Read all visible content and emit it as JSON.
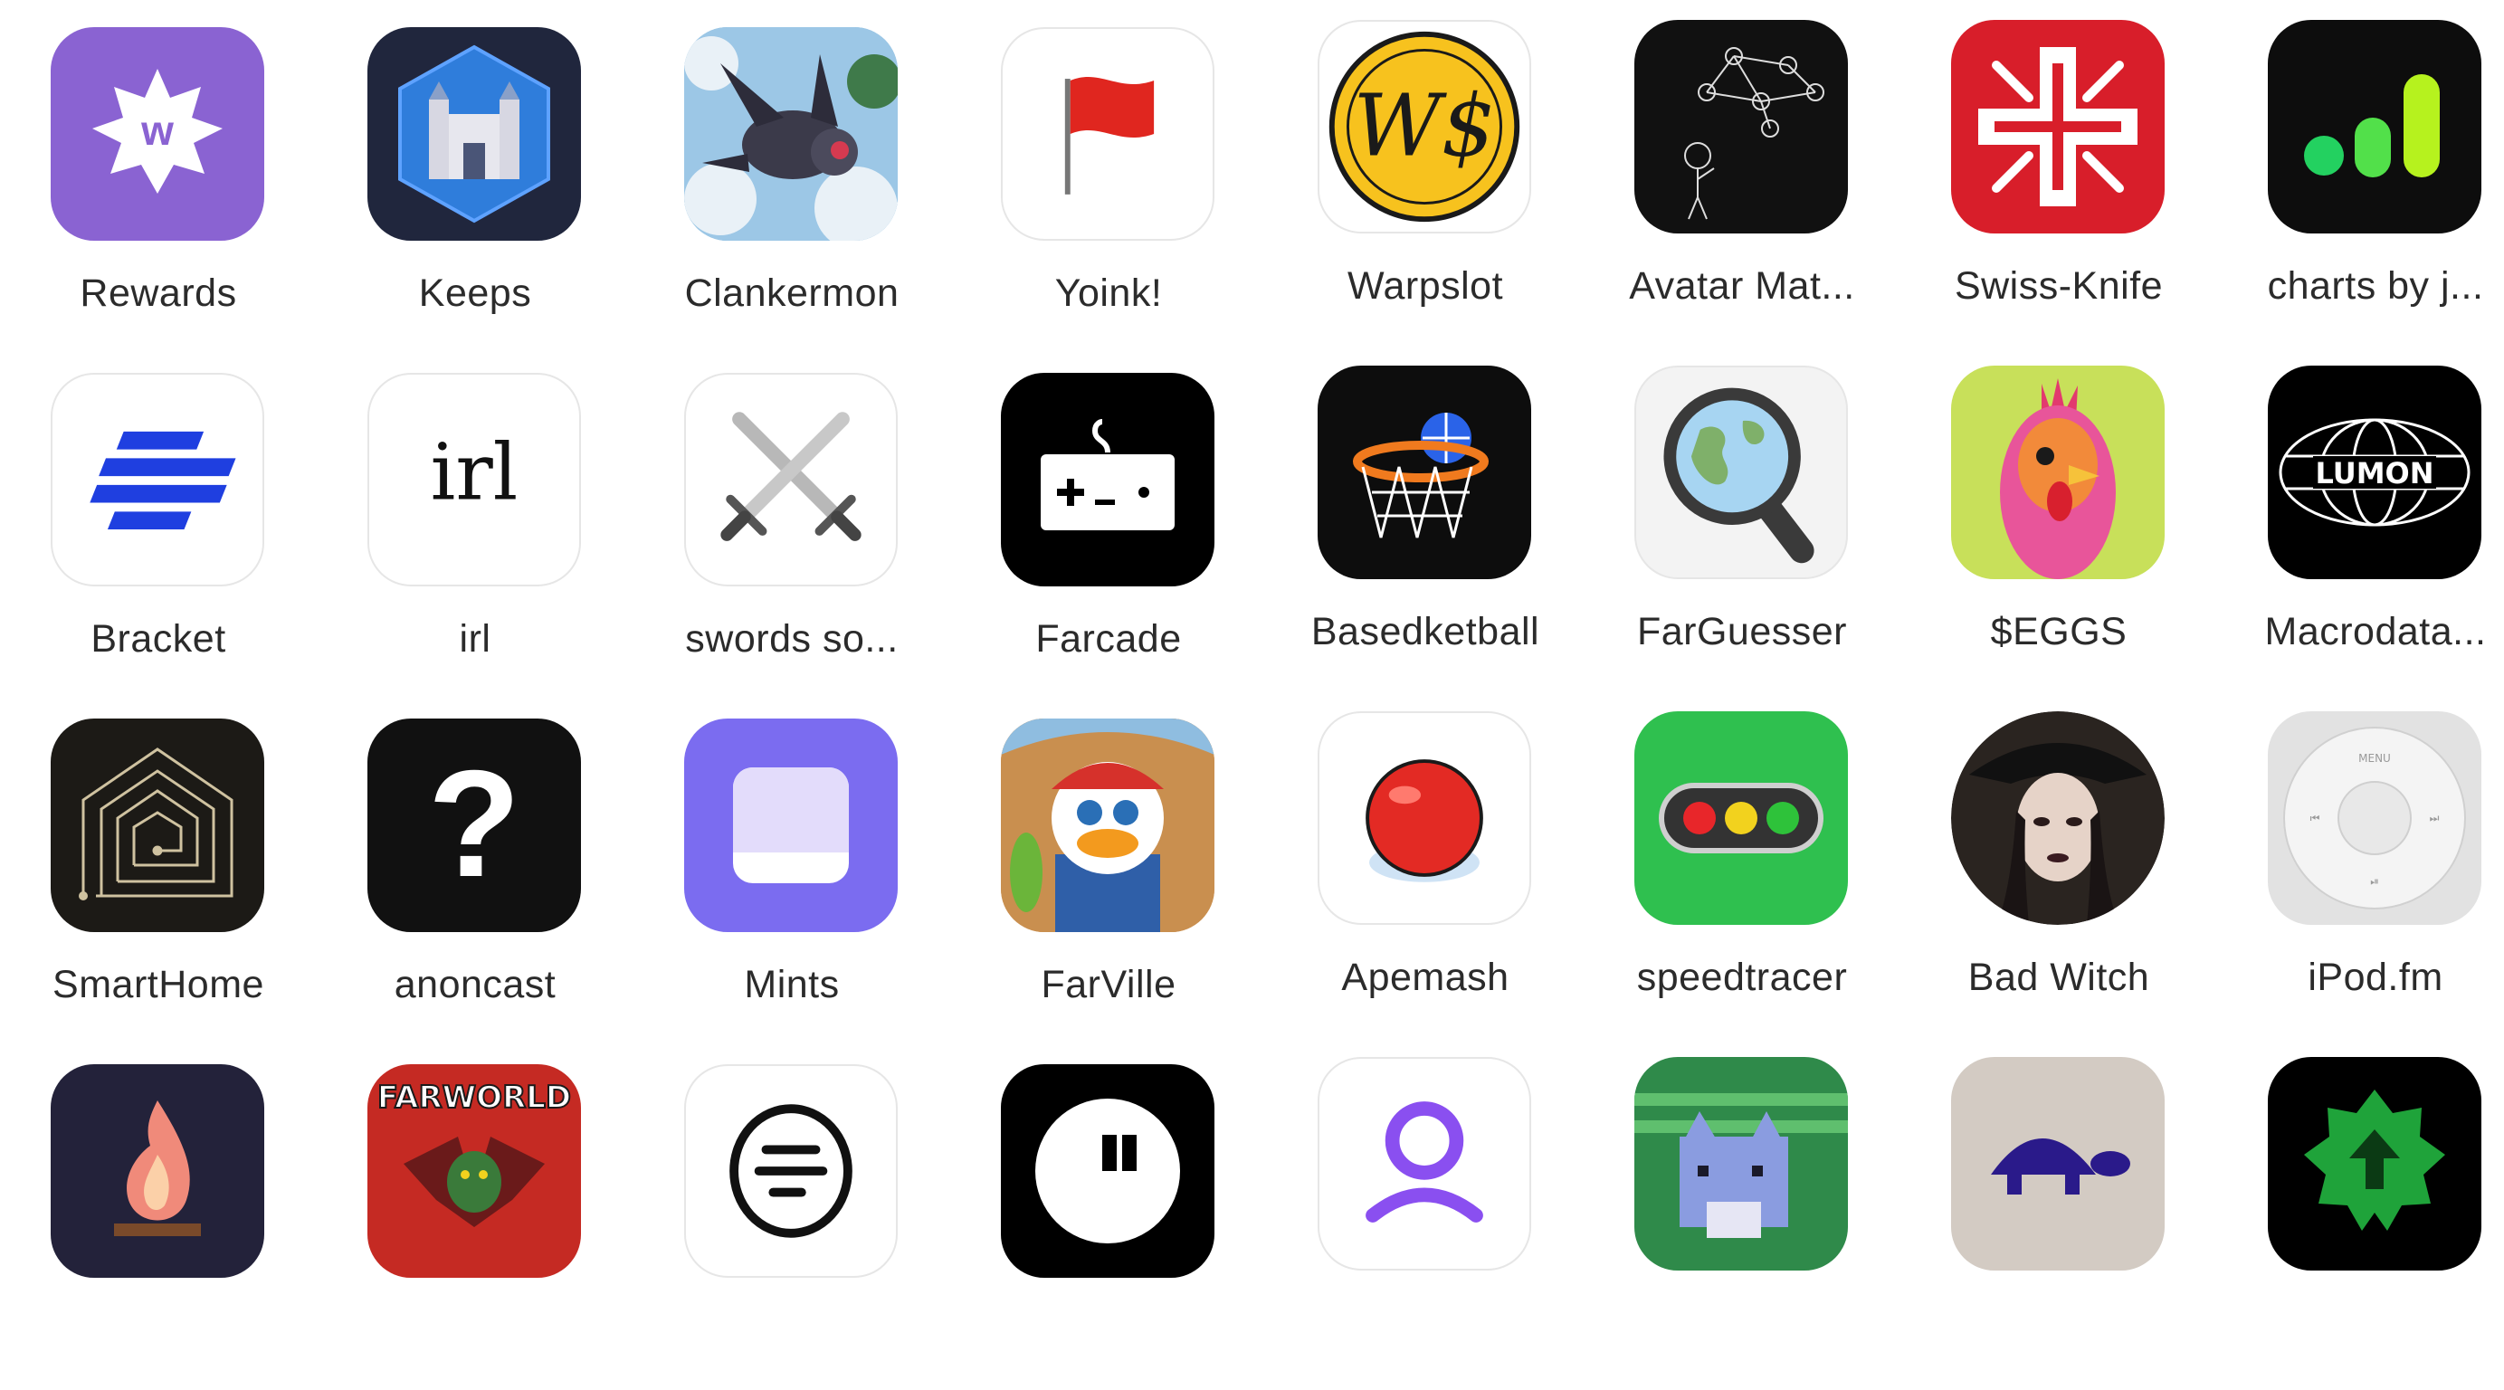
{
  "apps": [
    {
      "name": "Rewards",
      "icon": "rewards-star-icon",
      "bg": "#8a63d2"
    },
    {
      "name": "Keeps",
      "icon": "castle-hexagon-icon",
      "bg": "#20263d"
    },
    {
      "name": "Clankermon",
      "icon": "robot-dragon-icon",
      "bg": "#7ab3d6"
    },
    {
      "name": "Yoink!",
      "icon": "red-flag-icon",
      "bg": "#ffffff"
    },
    {
      "name": "Warpslot",
      "icon": "gold-coin-icon",
      "bg": "#ffffff"
    },
    {
      "name": "Avatar Mat...",
      "icon": "network-thinker-icon",
      "bg": "#111111"
    },
    {
      "name": "Swiss-Knife",
      "icon": "swiss-cross-tools-icon",
      "bg": "#d81e2a"
    },
    {
      "name": "charts by j...",
      "icon": "signal-bars-icon",
      "bg": "#0d0d0d"
    },
    {
      "name": "Bracket",
      "icon": "bracket-stripes-icon",
      "bg": "#ffffff"
    },
    {
      "name": "irl",
      "icon": "irl-text-icon",
      "bg": "#ffffff",
      "glyph": "irl"
    },
    {
      "name": "swords so...",
      "icon": "crossed-swords-icon",
      "bg": "#ffffff"
    },
    {
      "name": "Farcade",
      "icon": "game-controller-icon",
      "bg": "#000000"
    },
    {
      "name": "Basedketball",
      "icon": "basketball-hoop-icon",
      "bg": "#0d0d0d"
    },
    {
      "name": "FarGuesser",
      "icon": "magnifier-globe-icon",
      "bg": "#f3f3f3"
    },
    {
      "name": "$EGGS",
      "icon": "rooster-icon",
      "bg": "#c8e05a"
    },
    {
      "name": "Macrodata...",
      "icon": "lumon-globe-icon",
      "bg": "#000000",
      "glyph": "LUMON"
    },
    {
      "name": "SmartHome",
      "icon": "house-spiral-icon",
      "bg": "#1c1a16"
    },
    {
      "name": "anoncast",
      "icon": "question-mark-icon",
      "bg": "#111111",
      "glyph": "?"
    },
    {
      "name": "Mints",
      "icon": "lavender-square-icon",
      "bg": "#7b6cf0"
    },
    {
      "name": "FarVille",
      "icon": "farm-duck-icon",
      "bg": "#d69a58"
    },
    {
      "name": "Apemash",
      "icon": "red-button-icon",
      "bg": "#ffffff"
    },
    {
      "name": "speedtracer",
      "icon": "traffic-light-icon",
      "bg": "#2fc04f"
    },
    {
      "name": "Bad Witch",
      "icon": "witch-portrait-icon",
      "bg": "#2a2420"
    },
    {
      "name": "iPod.fm",
      "icon": "ipod-wheel-icon",
      "bg": "#e2e2e2",
      "glyph": "MENU"
    },
    {
      "name": "",
      "icon": "pixel-campfire-icon",
      "bg": "#23223a"
    },
    {
      "name": "",
      "icon": "farworld-dragon-icon",
      "bg": "#c52a23",
      "glyph": "FARWORLD"
    },
    {
      "name": "",
      "icon": "equal-lines-circle-icon",
      "bg": "#ffffff"
    },
    {
      "name": "",
      "icon": "quote-bubble-icon",
      "bg": "#000000"
    },
    {
      "name": "",
      "icon": "person-outline-icon",
      "bg": "#ffffff"
    },
    {
      "name": "",
      "icon": "pixel-cat-icon",
      "bg": "#2f8a4a"
    },
    {
      "name": "",
      "icon": "turtle-icon",
      "bg": "#d3cbc3"
    },
    {
      "name": "",
      "icon": "upload-badge-icon",
      "bg": "#000000"
    }
  ]
}
